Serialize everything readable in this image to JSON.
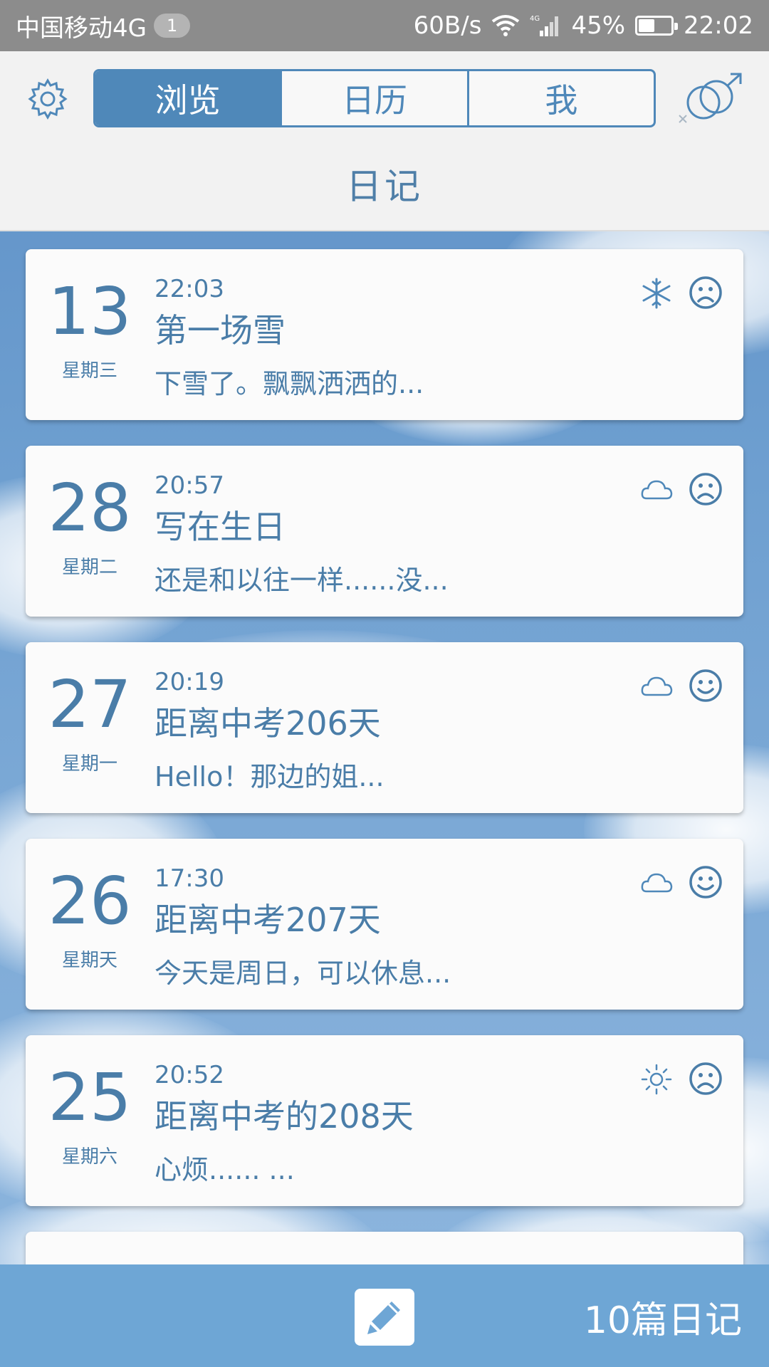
{
  "status_bar": {
    "carrier": "中国移动4G",
    "sim_badge": "1",
    "speed": "60B/s",
    "battery": "45%",
    "battery_level": 0.45,
    "time": "22:02"
  },
  "header": {
    "tabs": [
      {
        "label": "浏览",
        "active": true
      },
      {
        "label": "日历",
        "active": false
      },
      {
        "label": "我",
        "active": false
      }
    ],
    "title": "日记",
    "settings_icon": "gear-icon",
    "gender_icon": "gender-icon"
  },
  "entries": [
    {
      "day": "13",
      "weekday": "星期三",
      "time": "22:03",
      "title": "第一场雪",
      "preview": "下雪了。飘飘洒洒的...",
      "weather": "snow",
      "mood": "sad"
    },
    {
      "day": "28",
      "weekday": "星期二",
      "time": "20:57",
      "title": "写在生日",
      "preview": "还是和以往一样......没...",
      "weather": "cloudy",
      "mood": "sad"
    },
    {
      "day": "27",
      "weekday": "星期一",
      "time": "20:19",
      "title": "距离中考206天",
      "preview": "Hello！那边的姐...",
      "weather": "cloudy",
      "mood": "happy"
    },
    {
      "day": "26",
      "weekday": "星期天",
      "time": "17:30",
      "title": "距离中考207天",
      "preview": "今天是周日，可以休息...",
      "weather": "cloudy",
      "mood": "happy"
    },
    {
      "day": "25",
      "weekday": "星期六",
      "time": "20:52",
      "title": "距离中考的208天",
      "preview": "心烦......     ...",
      "weather": "sunny",
      "mood": "sad"
    }
  ],
  "bottom_bar": {
    "compose_icon": "pencil-icon",
    "count": "10篇日记"
  },
  "colors": {
    "accent": "#4f88b9",
    "text": "#4a7da8",
    "bottom_bar": "#6ea6d5",
    "header_bg": "#f2f2f2"
  }
}
